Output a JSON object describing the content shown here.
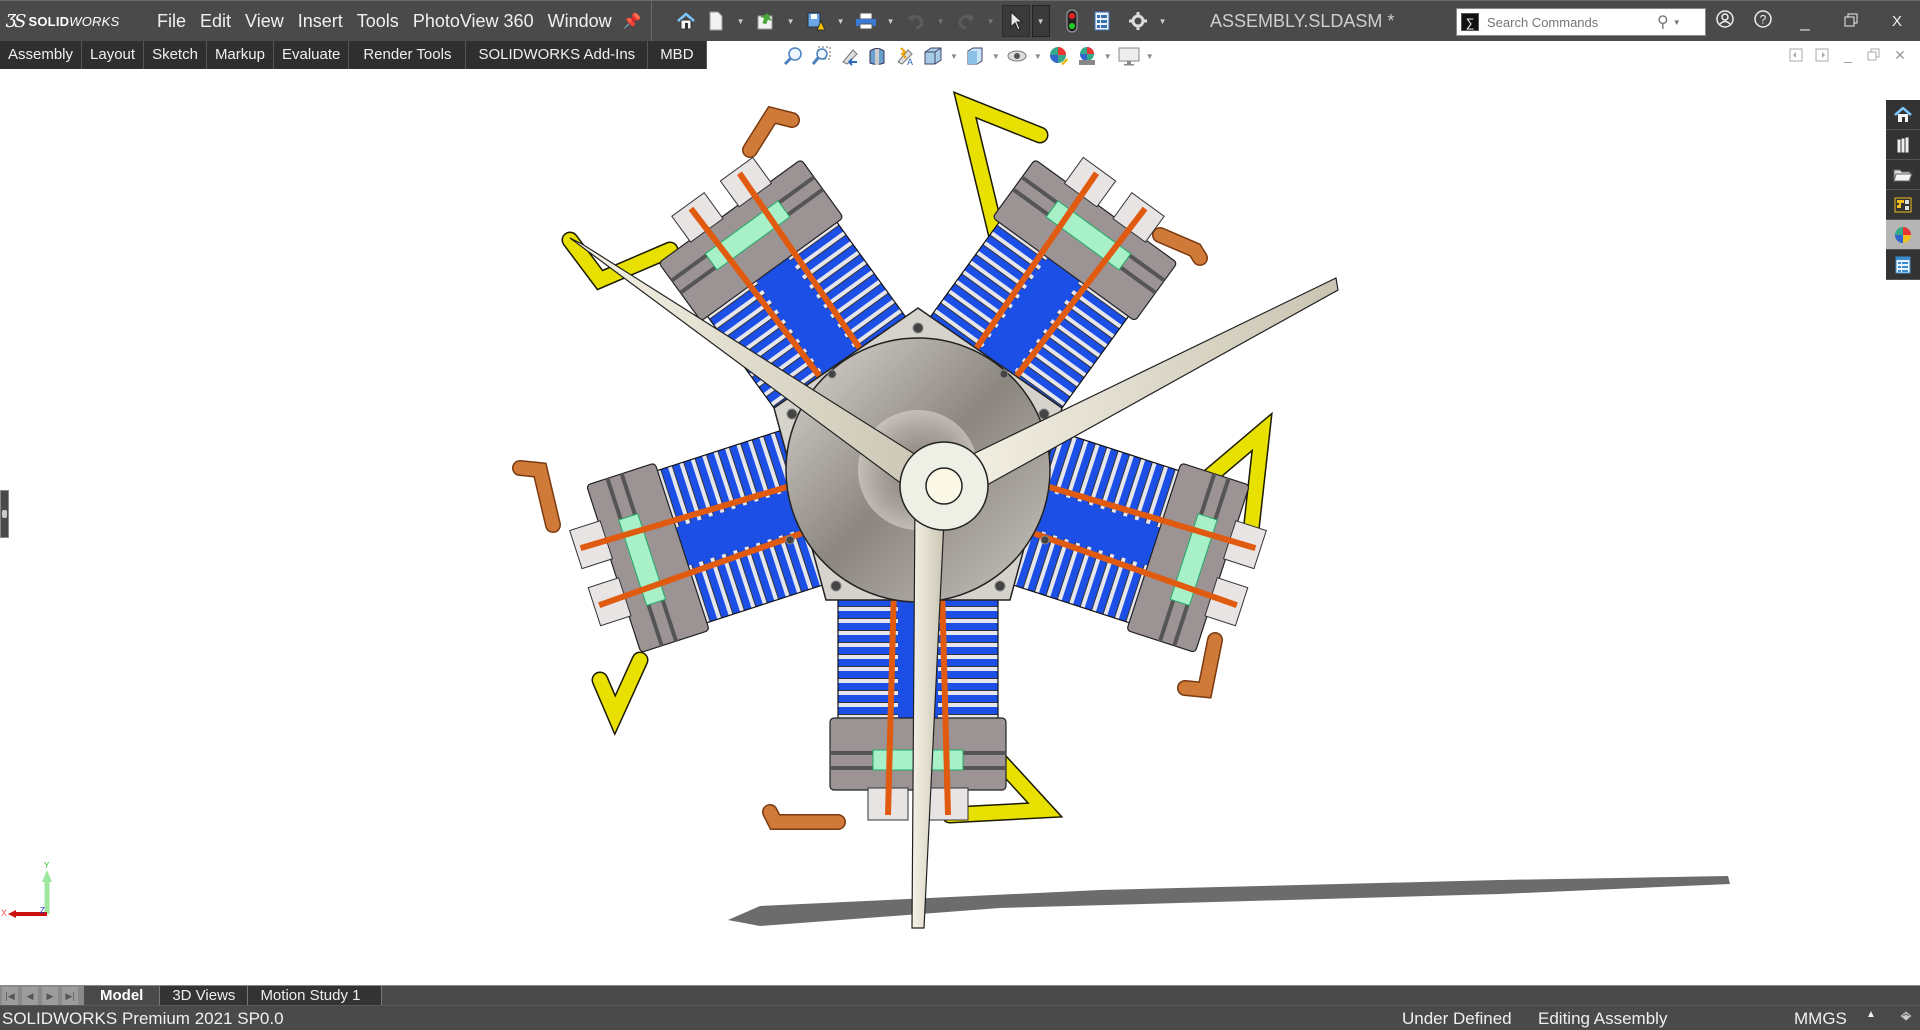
{
  "app": {
    "brand": "SOLIDWORKS",
    "brand_bold": "SOLID",
    "brand_light": "WORKS",
    "document_title": "ASSEMBLY.SLDASM *"
  },
  "menu": [
    "File",
    "Edit",
    "View",
    "Insert",
    "Tools",
    "PhotoView 360",
    "Window"
  ],
  "quick_access": [
    {
      "icon": "home-icon",
      "dropdown": false
    },
    {
      "icon": "new-document-icon",
      "dropdown": true
    },
    {
      "icon": "open-folder-icon",
      "dropdown": true
    },
    {
      "icon": "save-warning-icon",
      "dropdown": true
    },
    {
      "icon": "print-icon",
      "dropdown": true
    },
    {
      "icon": "undo-icon",
      "dropdown": true,
      "disabled": true
    },
    {
      "icon": "redo-icon",
      "dropdown": true,
      "disabled": true
    },
    {
      "icon": "select-cursor-icon",
      "dropdown": true,
      "selected": true
    },
    {
      "icon": "rebuild-traffic-light-icon",
      "dropdown": false
    },
    {
      "icon": "file-properties-icon",
      "dropdown": false
    },
    {
      "icon": "options-gear-icon",
      "dropdown": true
    }
  ],
  "search": {
    "placeholder": "Search Commands"
  },
  "window_controls": {
    "account": "account-icon",
    "help": "help-icon",
    "minimize": "_",
    "restore": "restore-icon",
    "close": "X"
  },
  "command_tabs": [
    "Assembly",
    "Layout",
    "Sketch",
    "Markup",
    "Evaluate",
    "Render Tools",
    "SOLIDWORKS Add-Ins",
    "MBD"
  ],
  "heads_up_view_toolbar": [
    "zoom-to-fit-icon",
    "zoom-to-area-icon",
    "previous-view-icon",
    "section-view-icon",
    "dynamic-annotation-views-icon",
    "view-orientation-icon",
    "display-style-icon",
    "hide-show-items-icon",
    "edit-appearance-icon",
    "apply-scene-icon",
    "view-settings-icon"
  ],
  "task_pane": [
    {
      "name": "solidworks-resources",
      "icon": "home-icon",
      "active": false
    },
    {
      "name": "design-library",
      "icon": "library-books-icon",
      "active": false
    },
    {
      "name": "file-explorer",
      "icon": "folder-icon",
      "active": false
    },
    {
      "name": "view-palette",
      "icon": "view-palette-icon",
      "active": false
    },
    {
      "name": "appearances-scenes-decals",
      "icon": "appearance-ball-icon",
      "active": true
    },
    {
      "name": "custom-properties",
      "icon": "properties-list-icon",
      "active": false
    }
  ],
  "viewport": {
    "model": "Five-cylinder radial engine with three-blade propeller",
    "triad": {
      "x_label": "X",
      "y_label": "Y",
      "z_label": "Z"
    },
    "colors": {
      "cylinder_blue": "#1c4fe6",
      "fin_gray": "#9a9090",
      "pushrod_orange": "#e05a10",
      "intake_yellow": "#e8e000",
      "exhaust_copper": "#d07a3a",
      "rocker_mint": "#a8f0c8",
      "crankcase_silver": "#b8b4ae",
      "propeller_cream": "#e8e4d4",
      "shadow_gray": "#6c6c6c"
    }
  },
  "bottom_tabs": [
    {
      "label": "Model",
      "active": true
    },
    {
      "label": "3D Views",
      "active": false
    },
    {
      "label": "Motion Study 1",
      "active": false
    }
  ],
  "status": {
    "product": "SOLIDWORKS Premium 2021 SP0.0",
    "definition": "Under Defined",
    "mode": "Editing Assembly",
    "units": "MMGS",
    "units_arrow": "▲"
  }
}
